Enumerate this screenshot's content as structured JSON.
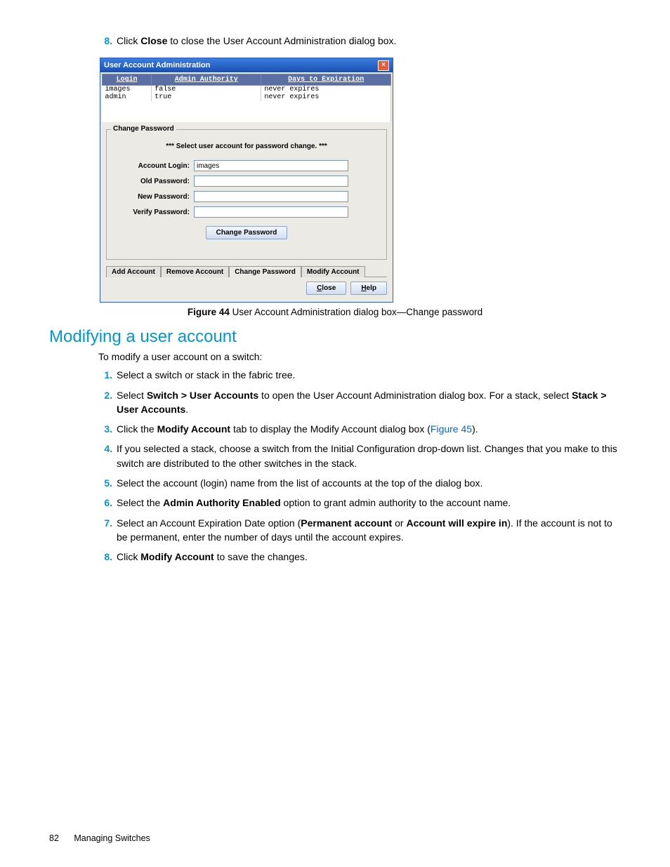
{
  "step8": {
    "num": "8.",
    "pre": "Click ",
    "bold": "Close",
    "post": " to close the User Account Administration dialog box."
  },
  "dialog": {
    "title": "User Account Administration",
    "closeGlyph": "×",
    "columns": {
      "c1": "Login",
      "c2": "Admin Authority",
      "c3": "Days to Expiration"
    },
    "rows": [
      {
        "login": "images",
        "admin": "false",
        "exp": "never expires"
      },
      {
        "login": "admin",
        "admin": "true",
        "exp": "never expires"
      }
    ],
    "fieldset": "Change Password",
    "selectMsg": "*** Select user account for password change. ***",
    "labels": {
      "accountLogin": "Account Login:",
      "oldPwd": "Old Password:",
      "newPwd": "New Password:",
      "verifyPwd": "Verify Password:"
    },
    "values": {
      "accountLogin": "images"
    },
    "changeBtn": "Change Password",
    "tabs": {
      "add": "Add Account",
      "remove": "Remove Account",
      "change": "Change Password",
      "modify": "Modify Account"
    },
    "bottom": {
      "close": "Close",
      "help": "Help"
    }
  },
  "caption": {
    "bold": "Figure 44",
    "rest": " User Account Administration dialog box—Change password"
  },
  "section": "Modifying a user account",
  "intro": "To modify a user account on a switch:",
  "steps": {
    "s1": {
      "num": "1.",
      "text": "Select a switch or stack in the fabric tree."
    },
    "s2": {
      "num": "2.",
      "pre": "Select ",
      "b1": "Switch > User Accounts",
      "mid": " to open the User Account Administration dialog box. For a stack, select ",
      "b2": "Stack > User Accounts",
      "post": "."
    },
    "s3": {
      "num": "3.",
      "pre": "Click the ",
      "b1": "Modify Account",
      "mid": " tab to display the Modify Account dialog box (",
      "link": "Figure 45",
      "post": ")."
    },
    "s4": {
      "num": "4.",
      "text": "If you selected a stack, choose a switch from the Initial Configuration drop-down list. Changes that you make to this switch are distributed to the other switches in the stack."
    },
    "s5": {
      "num": "5.",
      "text": "Select the account (login) name from the list of accounts at the top of the dialog box."
    },
    "s6": {
      "num": "6.",
      "pre": "Select the ",
      "b1": "Admin Authority Enabled",
      "post": " option to grant admin authority to the account name."
    },
    "s7": {
      "num": "7.",
      "pre": "Select an Account Expiration Date option (",
      "b1": "Permanent account",
      "mid": " or ",
      "b2": "Account will expire in",
      "post": "). If the account is not to be permanent, enter the number of days until the account expires."
    },
    "s8": {
      "num": "8.",
      "pre": "Click ",
      "b1": "Modify Account",
      "post": " to save the changes."
    }
  },
  "footer": {
    "page": "82",
    "chapter": "Managing Switches"
  }
}
